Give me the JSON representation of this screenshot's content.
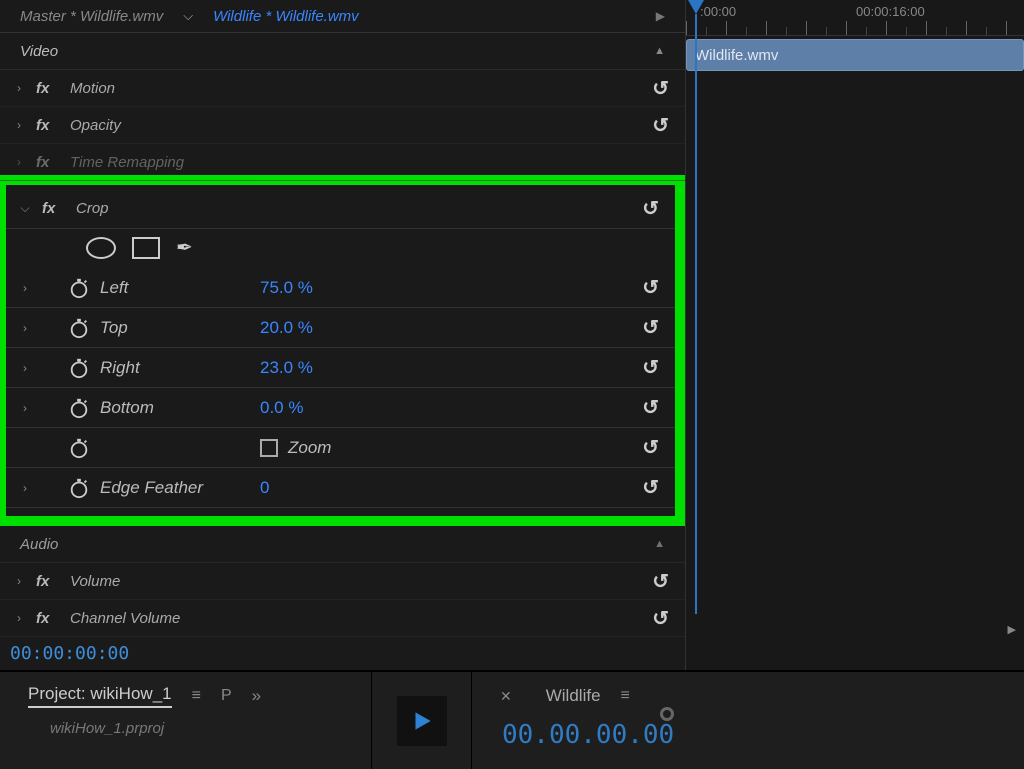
{
  "header": {
    "master": "Master * Wildlife.wmv",
    "title": "Wildlife * Wildlife.wmv"
  },
  "sections": {
    "video": "Video",
    "audio": "Audio"
  },
  "effects": {
    "motion": "Motion",
    "opacity": "Opacity",
    "timeRemap": "Time Remapping",
    "crop": "Crop",
    "volume": "Volume",
    "channelVolume": "Channel Volume"
  },
  "crop": {
    "left": {
      "label": "Left",
      "value": "75.0 %"
    },
    "top": {
      "label": "Top",
      "value": "20.0 %"
    },
    "right": {
      "label": "Right",
      "value": "23.0 %"
    },
    "bottom": {
      "label": "Bottom",
      "value": "0.0 %"
    },
    "zoom": "Zoom",
    "edgeFeather": {
      "label": "Edge Feather",
      "value": "0"
    }
  },
  "timecodes": {
    "current": "00:00:00:00",
    "ruler_a": ":00:00",
    "ruler_b": "00:00:16:00",
    "bottom": "00.00.00.00"
  },
  "clip": {
    "name": "Wildlife.wmv"
  },
  "bottom": {
    "project_title": "Project: wikiHow_1",
    "p": "P",
    "timeline_title": "Wildlife",
    "fileRow": "wikiHow_1.prproj"
  }
}
